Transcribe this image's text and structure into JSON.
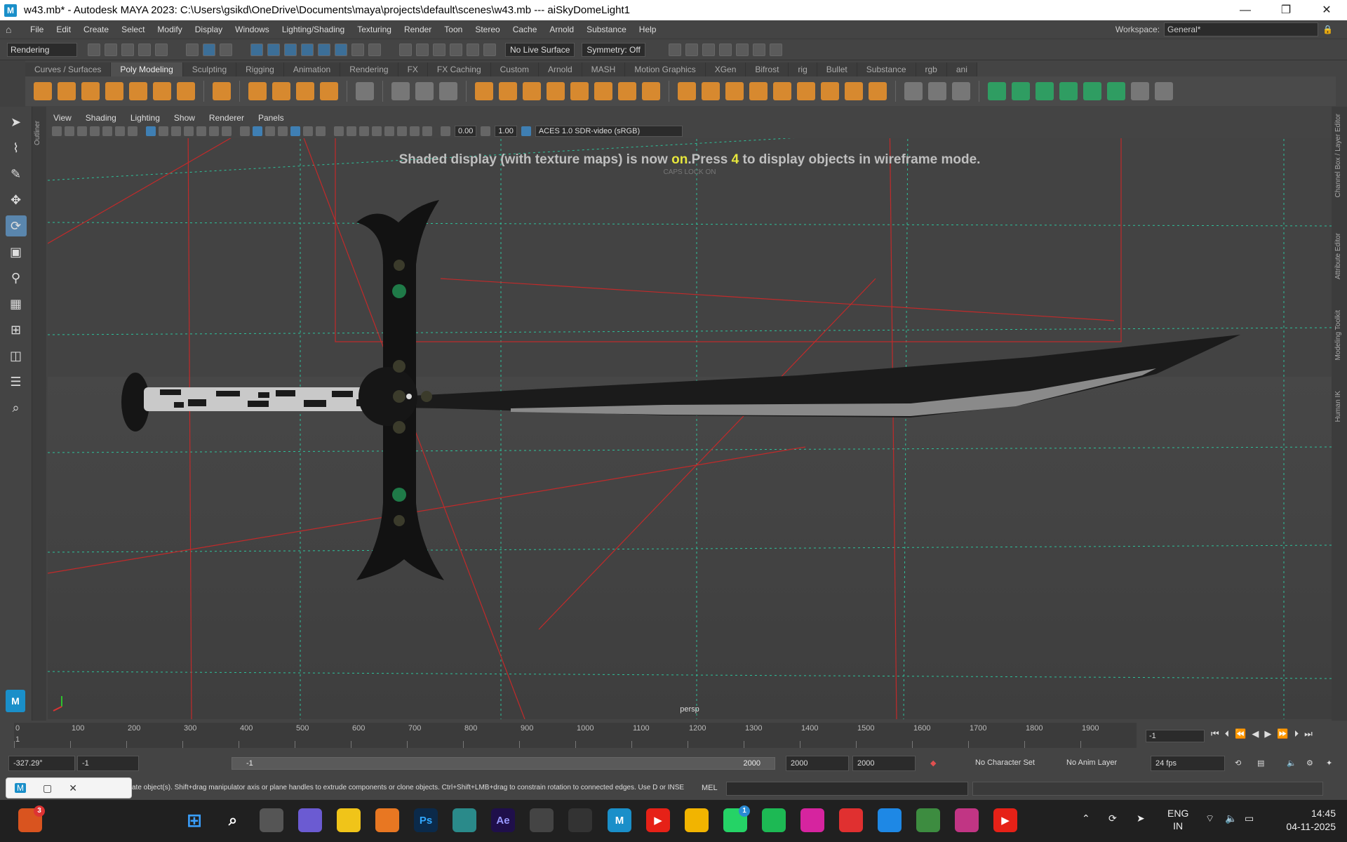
{
  "window": {
    "title": "w43.mb* - Autodesk MAYA 2023: C:\\Users\\gsikd\\OneDrive\\Documents\\maya\\projects\\default\\scenes\\w43.mb   ---   aiSkyDomeLight1",
    "app_icon": "M",
    "minimize": "—",
    "restore": "❐",
    "close": "✕"
  },
  "menu": {
    "items": [
      "File",
      "Edit",
      "Create",
      "Select",
      "Modify",
      "Display",
      "Windows",
      "Lighting/Shading",
      "Texturing",
      "Render",
      "Toon",
      "Stereo",
      "Cache",
      "Arnold",
      "Substance",
      "Help"
    ],
    "workspace_label": "Workspace:",
    "workspace_value": "General*"
  },
  "statusline": {
    "mode": "Rendering",
    "live_surface": "No Live Surface",
    "symmetry": "Symmetry: Off"
  },
  "shelf": {
    "tabs": [
      "Curves / Surfaces",
      "Poly Modeling",
      "Sculpting",
      "Rigging",
      "Animation",
      "Rendering",
      "FX",
      "FX Caching",
      "Custom",
      "Arnold",
      "MASH",
      "Motion Graphics",
      "XGen",
      "Bifrost",
      "rig",
      "Bullet",
      "Substance",
      "rgb",
      "ani"
    ],
    "active_tab": "Poly Modeling"
  },
  "panel": {
    "menus": [
      "View",
      "Shading",
      "Lighting",
      "Show",
      "Renderer",
      "Panels"
    ],
    "exposure": "0.00",
    "gamma": "1.00",
    "color_mgmt": "ACES 1.0 SDR-video (sRGB)"
  },
  "viewport": {
    "hud_pre": "Shaded display (with texture maps) is now ",
    "hud_on": "on",
    "hud_mid": ".Press ",
    "hud_key": "4",
    "hud_post": " to display objects in wireframe mode.",
    "caps": "CAPS LOCK ON",
    "camera": "persp"
  },
  "side_panels": {
    "left": "Outliner",
    "right": [
      "Channel Box / Layer Editor",
      "Attribute Editor",
      "Modeling Toolkit",
      "Human IK"
    ]
  },
  "timeline": {
    "ticks": [
      "0",
      "100",
      "200",
      "300",
      "400",
      "500",
      "600",
      "700",
      "800",
      "900",
      "1000",
      "1100",
      "1200",
      "1300",
      "1400",
      "1500",
      "1600",
      "1700",
      "1800",
      "1900"
    ],
    "start_mark": "1",
    "current_frame": "-1"
  },
  "range": {
    "coord": "-327.29°",
    "start": "-1",
    "bar_start": "-1",
    "bar_end": "2000",
    "end1": "2000",
    "end2": "2000",
    "char_set": "No Character Set",
    "anim_layer": "No Anim Layer",
    "fps": "24 fps"
  },
  "help": {
    "text": "ate object(s). Shift+drag manipulator axis or plane handles to extrude components or clone objects. Ctrl+Shift+LMB+drag to constrain rotation to connected edges. Use D or INSE",
    "mel": "MEL"
  },
  "taskbar": {
    "badge_first": "3",
    "badge_whatsapp": "1",
    "ps": "Ps",
    "ae": "Ae",
    "maya": "M",
    "lang": "ENG",
    "region": "IN",
    "time": "14:45",
    "date": "04-11-2025"
  }
}
